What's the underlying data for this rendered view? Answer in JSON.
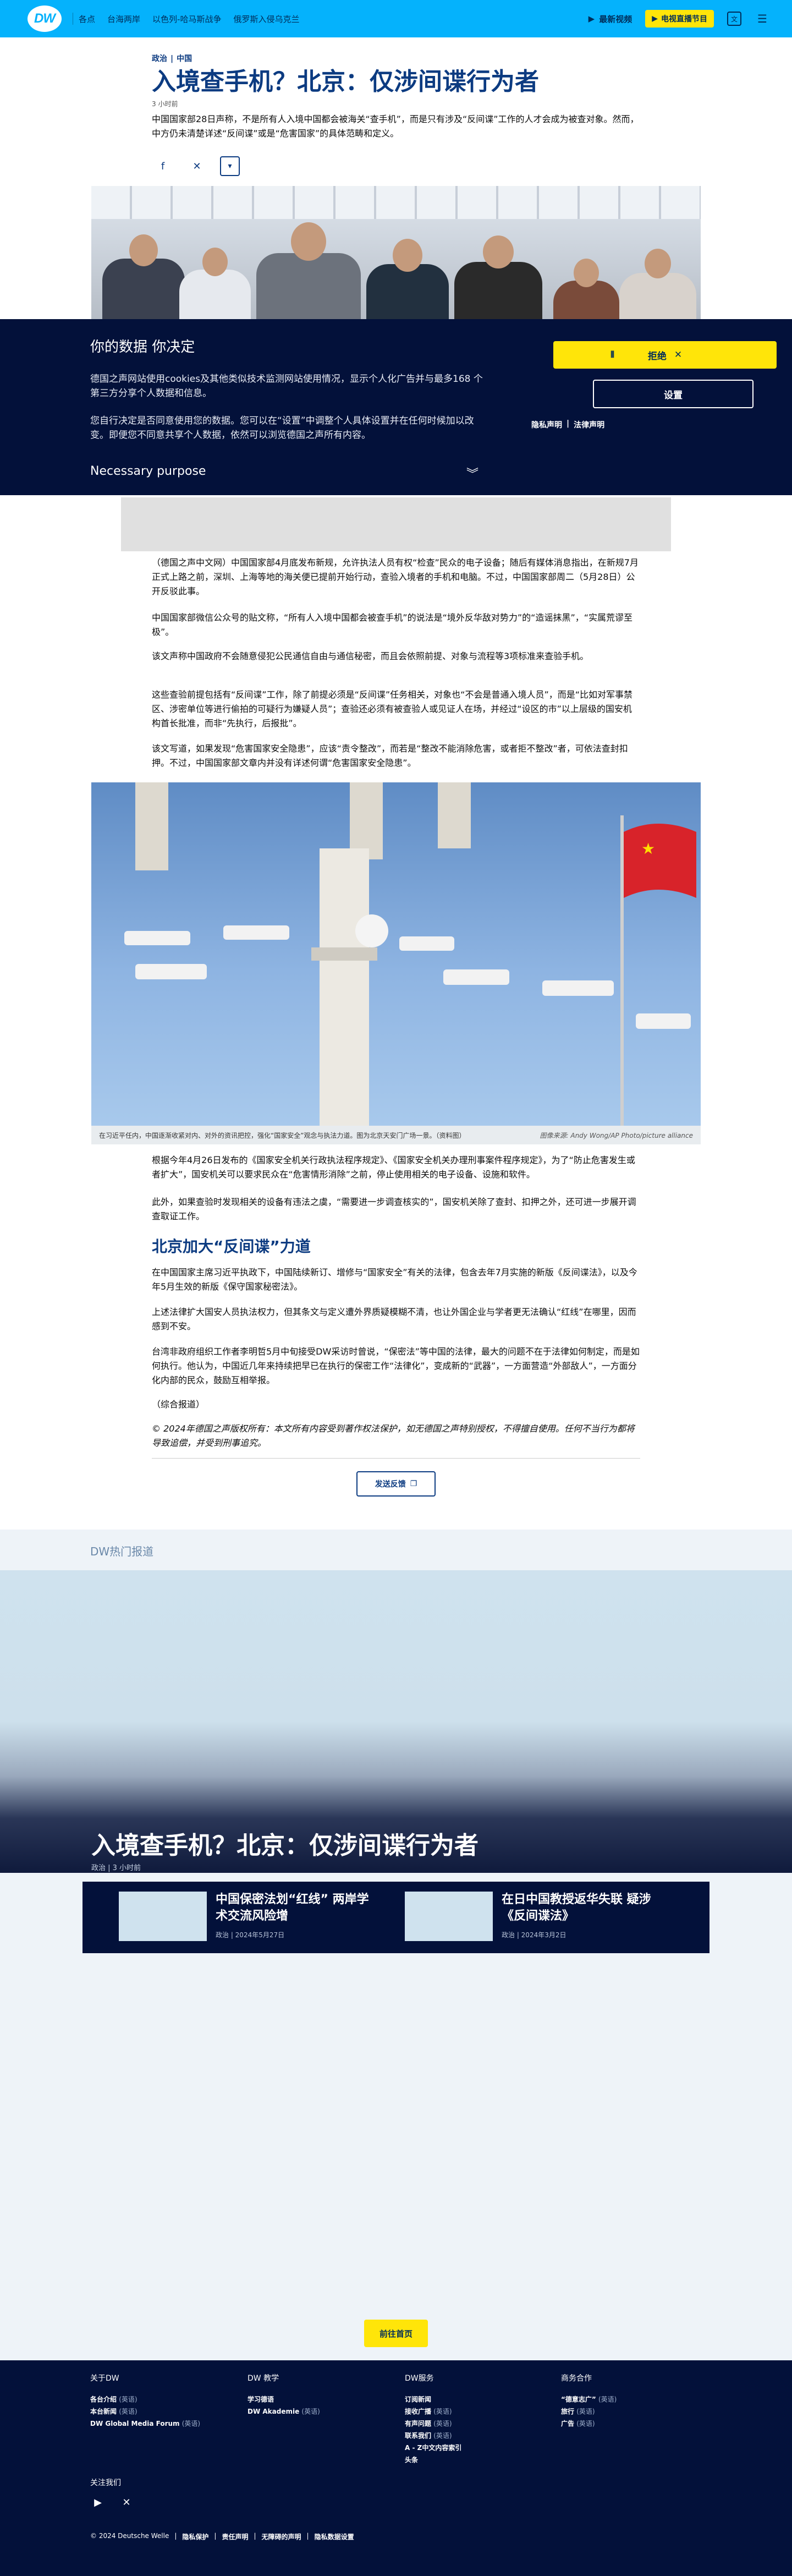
{
  "nav": {
    "logo": "DW",
    "links": [
      "各点",
      "台海两岸",
      "以色列-哈马斯战争",
      "俄罗斯入侵乌克兰"
    ],
    "latest_video": "最新视频",
    "live_tv": "电视直播节目"
  },
  "article": {
    "kicker_1": "政治",
    "kicker_2": "中国",
    "headline": "入境查手机？北京：仅涉间谍行为者",
    "time_ago": "3 小时前",
    "lead": "中国国家部28日声称，不是所有人入境中国都会被海关“查手机”，而是只有涉及“反间谍”工作的人才会成为被查对象。然而，中方仍未清楚详述“反间谍”或是“危害国家”的具体范畴和定义。",
    "p1": "（德国之声中文网）中国国家部4月底发布新规，允许执法人员有权“检查”民众的电子设备；随后有媒体消息指出，在新规7月正式上路之前，深圳、上海等地的海关便已提前开始行动，查验入境者的手机和电脑。不过，中国国家部周二（5月28日）公开反驳此事。",
    "p2": "中国国家部微信公众号的贴文称，“所有人入境中国都会被查手机”的说法是“境外反华敌对势力”的“造谣抹黑”，“实属荒谬至极”。",
    "p3": "该文声称中国政府不会随意侵犯公民通信自由与通信秘密，而且会依照前提、对象与流程等3项标准来查验手机。",
    "p4": "这些查验前提包括有“反间谍”工作，除了前提必须是“反间谍”任务相关，对象也“不会是普通入境人员”，而是“比如对军事禁区、涉密单位等进行偷拍的可疑行为嫌疑人员”；查验还必须有被查验人或见证人在场，并经过“设区的市”以上层级的国安机构首长批准，而非“先执行，后报批”。",
    "p5": "该文写道，如果发现“危害国家安全隐患”，应该“责令整改”，而若是“整改不能消除危害，或者拒不整改”者，可依法查封扣押。不过，中国国家部文章内并没有详述何谓“危害国家安全隐患”。",
    "caption": "在习近平任内，中国逐渐收紧对内、对外的资讯把控，强化“国家安全”观念与执法力道。图为北京天安门广场一景。（资料图）",
    "credit": "图像来源: Andy Wong/AP Photo/picture alliance",
    "p6": "根据今年4月26日发布的《国家安全机关行政执法程序规定》、《国家安全机关办理刑事案件程序规定》，为了“防止危害发生或者扩大”，国安机关可以要求民众在“危害情形消除”之前，停止使用相关的电子设备、设施和软件。",
    "p7": "此外，如果查验时发现相关的设备有违法之虞，“需要进一步调查核实的”，国安机关除了查封、扣押之外，还可进一步展开调查取证工作。",
    "h2": "北京加大“反间谍”力道",
    "p8": "在中国国家主席习近平执政下，中国陆续新订、增修与“国家安全”有关的法律，包含去年7月实施的新版《反间谍法》，以及今年5月生效的新版《保守国家秘密法》。",
    "p9": "上述法律扩大国安人员执法权力，但其条文与定义遭外界质疑模糊不清，也让外国企业与学者更无法确认“红线”在哪里，因而感到不安。",
    "p10": "台湾非政府组织工作者李明哲5月中旬接受DW采访时曾说，“保密法”等中国的法律，最大的问题不在于法律如何制定，而是如何执行。他认为，中国近几年来持续把早已在执行的保密工作“法律化”，变成新的“武器”，一方面营造“外部敌人”，一方面分化内部的民众，鼓励互相举报。",
    "p11": "（综合报道）",
    "copyright": "© 2024年德国之声版权所有：本文所有内容受到著作权法保护，如无德国之声特别授权，不得擅自使用。任何不当行为都将导致追偿，并受到刑事追究。",
    "feedback": "发送反馈"
  },
  "cookie": {
    "title": "你的数据 你决定",
    "p1": "德国之声网站使用cookies及其他类似技术监测网站使用情况，显示个人化广告并与最多168 个第三方分享个人数据和信息。",
    "p2": "您自行决定是否同意使用您的数据。您可以在“设置”中调整个人具体设置并在任何时候加以改变。即便您不同意共享个人数据，依然可以浏览德国之声所有内容。",
    "reject": "拒绝",
    "settings": "设置",
    "privacy": "隐私声明",
    "legal": "法律声明",
    "purpose": "Necessary purpose"
  },
  "hot": {
    "title": "DW热门报道",
    "headline": "入境查手机？北京：仅涉间谍行为者",
    "meta": "政治 | 3 小时前",
    "related": [
      {
        "title": "中国保密法划“红线” 两岸学术交流风险增",
        "meta": "政治 | 2024年5月27日"
      },
      {
        "title": "在日中国教授返华失联 疑涉《反间谍法》",
        "meta": "政治 | 2024年3月2日"
      }
    ],
    "latest_btn": "前往首页"
  },
  "footer": {
    "cols": [
      {
        "title": "关于DW",
        "items": [
          [
            "各台介绍",
            "(英语)"
          ],
          [
            "本台新闻",
            "(英语)"
          ],
          [
            "DW Global Media Forum",
            "(英语)"
          ]
        ]
      },
      {
        "title": "DW 教学",
        "items": [
          [
            "学习德语",
            ""
          ],
          [
            "DW Akademie",
            "(英语)"
          ]
        ]
      },
      {
        "title": "DW服务",
        "items": [
          [
            "订阅新闻",
            ""
          ],
          [
            "接收广播",
            "(英语)"
          ],
          [
            "有声问题",
            "(英语)"
          ],
          [
            "联系我们",
            "(英语)"
          ],
          [
            "A - Z中文内容索引",
            ""
          ],
          [
            "头条",
            ""
          ]
        ]
      },
      {
        "title": "商务合作",
        "items": [
          [
            "“德意志广”",
            "(英语)"
          ],
          [
            "旅行",
            "(英语)"
          ],
          [
            "广告",
            "(英语)"
          ]
        ]
      }
    ],
    "follow": "关注我们",
    "legal": [
      "© 2024 Deutsche Welle",
      "隐私保护",
      "责任声明",
      "无障碍的声明",
      "隐私数据设置"
    ]
  },
  "colors": {
    "brand": "#05b2fc",
    "navy": "#03113a",
    "accent": "#ffe509",
    "headline": "#0c3b81"
  }
}
